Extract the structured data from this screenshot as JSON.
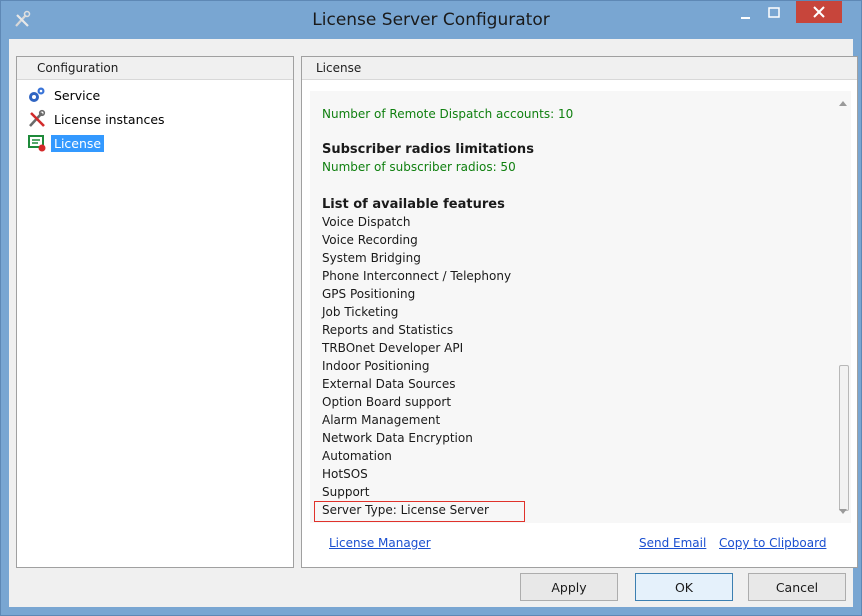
{
  "window": {
    "title": "License Server Configurator"
  },
  "left_panel": {
    "header": "Configuration",
    "items": [
      {
        "label": "Service",
        "icon": "gears-icon",
        "selected": false
      },
      {
        "label": "License instances",
        "icon": "tools-icon",
        "selected": false
      },
      {
        "label": "License",
        "icon": "license-icon",
        "selected": true
      }
    ]
  },
  "right_panel": {
    "header": "License",
    "remote_accounts": "Number of Remote Dispatch accounts: 10",
    "subscriber_title": "Subscriber radios limitations",
    "subscriber_count": "Number of subscriber radios: 50",
    "features_title": "List of available features",
    "features": [
      "Voice Dispatch",
      "Voice Recording",
      "System Bridging",
      "Phone Interconnect / Telephony",
      "GPS Positioning",
      "Job Ticketing",
      "Reports and Statistics",
      "TRBOnet Developer API",
      "Indoor Positioning",
      "External Data Sources",
      "Option Board support",
      "Alarm Management",
      "Network Data Encryption",
      "Automation",
      "HotSOS",
      "Support"
    ],
    "server_type": "Server Type: License Server",
    "links": {
      "license_manager": "License Manager",
      "send_email": "Send Email",
      "copy_clipboard": "Copy to Clipboard"
    }
  },
  "buttons": {
    "apply": "Apply",
    "ok": "OK",
    "cancel": "Cancel"
  },
  "colors": {
    "titlebar": "#79a6d2",
    "close_button": "#c7453b",
    "selection": "#3399ff",
    "green_text": "#108010",
    "link": "#1a4fd0",
    "highlight_border": "#e0322b"
  }
}
